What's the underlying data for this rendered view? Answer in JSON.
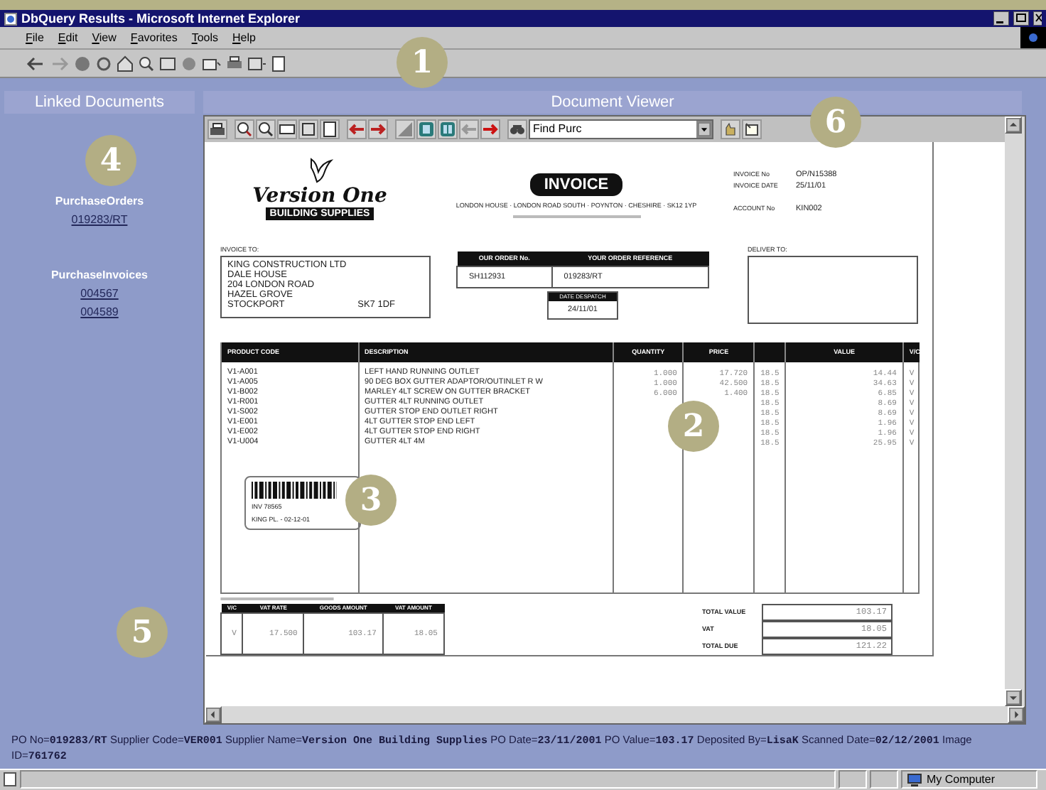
{
  "window": {
    "title": "DbQuery Results - Microsoft Internet Explorer"
  },
  "menu": [
    "File",
    "Edit",
    "View",
    "Favorites",
    "Tools",
    "Help"
  ],
  "linked_documents": {
    "title": "Linked Documents",
    "groups": [
      {
        "title": "PurchaseOrders",
        "links": [
          "019283/RT"
        ]
      },
      {
        "title": "PurchaseInvoices",
        "links": [
          "004567",
          "004589"
        ]
      }
    ]
  },
  "viewer": {
    "title": "Document Viewer",
    "find": {
      "value": "Find Purc"
    },
    "document": {
      "supplier": {
        "name": "Version One",
        "tagline": "BUILDING SUPPLIES"
      },
      "heading": "INVOICE",
      "address": "LONDON HOUSE · LONDON ROAD SOUTH · POYNTON · CHESHIRE · SK12 1YP",
      "details": [
        {
          "label": "INVOICE No",
          "value": "OP/N15388"
        },
        {
          "label": "INVOICE DATE",
          "value": "25/11/01"
        },
        {
          "label": "ACCOUNT No",
          "value": "KIN002"
        }
      ],
      "invoice_to": {
        "label": "INVOICE TO:",
        "lines": [
          "KING CONSTRUCTION LTD",
          "DALE HOUSE",
          "204 LONDON ROAD",
          "HAZEL GROVE"
        ],
        "town": "STOCKPORT",
        "postcode": "SK7 1DF"
      },
      "order": {
        "columns": [
          "OUR ORDER No.",
          "YOUR ORDER REFERENCE"
        ],
        "values": [
          "SH112931",
          "019283/RT"
        ],
        "despatch_label": "DATE DESPATCH",
        "despatch_date": "24/11/01"
      },
      "deliver_to": {
        "label": "DELIVER TO:"
      },
      "items": {
        "columns": [
          "PRODUCT CODE",
          "DESCRIPTION",
          "QUANTITY",
          "PRICE",
          "VALUE",
          "V/C"
        ],
        "rows": [
          {
            "code": "V1-A001",
            "description": "LEFT HAND RUNNING OUTLET",
            "quantity": "1.000",
            "price": "17.720",
            "column_5": "18.5",
            "value": "14.44",
            "vc": "V"
          },
          {
            "code": "V1-A005",
            "description": "90 DEG BOX GUTTER ADAPTOR/OUTINLET R W",
            "quantity": "1.000",
            "price": "42.500",
            "column_5": "18.5",
            "value": "34.63",
            "vc": "V"
          },
          {
            "code": "V1-B002",
            "description": "MARLEY 4LT SCREW ON GUTTER BRACKET",
            "quantity": "6.000",
            "price": "1.400",
            "column_5": "18.5",
            "value": "6.85",
            "vc": "V"
          },
          {
            "code": "V1-R001",
            "description": "GUTTER 4LT RUNNING OUTLET",
            "column_5": "18.5",
            "value": "8.69",
            "vc": "V"
          },
          {
            "code": "V1-S002",
            "description": "GUTTER STOP END OUTLET RIGHT",
            "column_5": "18.5",
            "value": "8.69",
            "vc": "V"
          },
          {
            "code": "V1-E001",
            "description": "4LT GUTTER STOP END LEFT",
            "column_5": "18.5",
            "value": "1.96",
            "vc": "V"
          },
          {
            "code": "V1-E002",
            "description": "4LT GUTTER STOP END RIGHT",
            "column_5": "18.5",
            "value": "1.96",
            "vc": "V"
          },
          {
            "code": "V1-U004",
            "description": "GUTTER 4LT 4M",
            "column_5": "18.5",
            "value": "25.95",
            "vc": "V"
          }
        ]
      },
      "barcode_label": {
        "lines": [
          "INV 78565",
          "KING PL. - 02-12-01"
        ]
      },
      "vat_table": {
        "columns": [
          "V/C",
          "VAT RATE",
          "GOODS AMOUNT",
          "VAT AMOUNT"
        ],
        "row": [
          "V",
          "17.500",
          "103.17",
          "18.05"
        ]
      },
      "totals": [
        {
          "label": "TOTAL VALUE",
          "value": "103.17"
        },
        {
          "label": "VAT",
          "value": "18.05"
        },
        {
          "label": "TOTAL DUE",
          "value": "121.22"
        }
      ]
    }
  },
  "info_text": "PO No=**019283/RT** Supplier Code=**VER001** Supplier Name=**Version One Building Supplies** PO Date=**23/11/2001** PO Value=**103.17** Deposited By=**LisaK** Scanned Date=**02/12/2001** Image ID=**761762**",
  "status_bar": {
    "zone": "My Computer"
  },
  "callouts": [
    "1",
    "2",
    "3",
    "4",
    "5",
    "6"
  ]
}
